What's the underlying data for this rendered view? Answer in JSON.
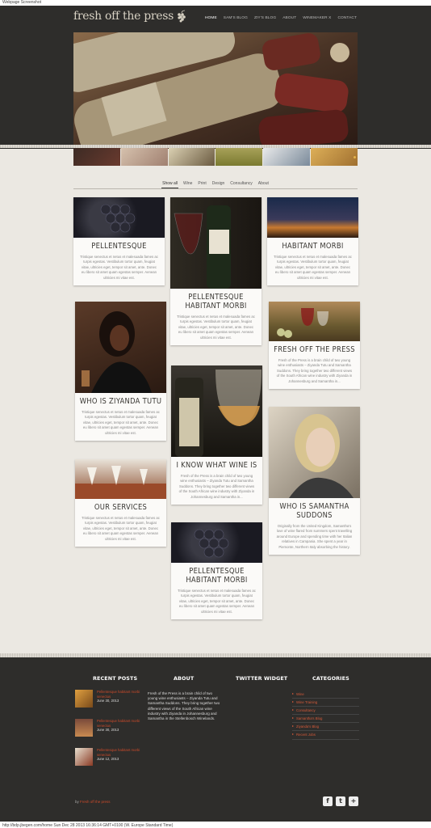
{
  "browser": {
    "top_caption": "Webpage Screenshot",
    "bottom_caption": "http://bdp.jbegen.com/home Sun Dec 28 2013 16:36:14 GMT+0100 (W. Europe Standard Time)"
  },
  "header": {
    "logo_text": "fresh off the press",
    "nav": [
      "HOME",
      "SAM'S BLOG",
      "ZIY'S BLOG",
      "ABOUT",
      "WINEMAKER X",
      "CONTACT"
    ],
    "active_nav": "HOME"
  },
  "filters": {
    "items": [
      "Show all",
      "Wine",
      "Print",
      "Design",
      "Consultancy",
      "About"
    ],
    "active": "Show all"
  },
  "cards": {
    "c1": {
      "title": "PELLENTESQUE",
      "text": "Tristique senectus et netus et malesuada fames ac turpis egestas. Vestibulum tortor quam, feugiat vitae, ultricies eget, tempor sit amet, ante. Donec eu libero sit amet quam egestas semper. Aenean ultricies mi vitae est."
    },
    "c2": {
      "title": "PELLENTESQUE HABITANT MORBI",
      "text": "Tristique senectus et netus et malesuada fames ac turpis egestas. Vestibulum tortor quam, feugiat vitae, ultricies eget, tempor sit amet, ante. Donec eu libero sit amet quam egestas semper. Aenean ultricies mi vitae est."
    },
    "c3": {
      "title": "HABITANT MORBI",
      "text": "Tristique senectus et netus et malesuada fames ac turpis egestas. Vestibulum tortor quam, feugiat vitae, ultricies eget, tempor sit amet, ante. Donec eu libero sit amet quam egestas semper. Aenean ultricies mi vitae est."
    },
    "c4": {
      "title": "WHO IS ZIYANDA TUTU",
      "text": "Tristique senectus et netus et malesuada fames ac turpis egestas. Vestibulum tortor quam, feugiat vitae, ultricies eget, tempor sit amet, ante. Donec eu libero sit amet quam egestas semper. Aenean ultricies mi vitae est."
    },
    "c5": {
      "title": "FRESH OFF THE PRESS",
      "text": "Fresh of the Press is a brain child of two young wine enthusiasts – Ziyanda Tutu and Samantha Suddons. They bring together two different views of the South African wine industry with Ziyanda in Johannesburg and Samantha in..."
    },
    "c6": {
      "title": "I KNOW WHAT WINE IS",
      "text": "Fresh of the Press is a brain child of two young wine enthusiasts – Ziyanda Tutu and Samantha Suddons. They bring together two different views of the South African wine industry with Ziyanda in Johannesburg and Samantha in..."
    },
    "c7": {
      "title": "OUR SERVICES",
      "text": "Tristique senectus et netus et malesuada fames ac turpis egestas. Vestibulum tortor quam, feugiat vitae, ultricies eget, tempor sit amet, ante. Donec eu libero sit amet quam egestas semper. Aenean ultricies mi vitae est."
    },
    "c8": {
      "title": "WHO IS SAMANTHA SUDDONS",
      "text": "Originally from the United Kingdom, Samantha's love of wine flared from summers spent travelling around Europe and spending time with her Italian relatives in Campania. She spent a year in Piemonte, Northern Italy absorbing the history."
    },
    "c9": {
      "title": "PELLENTESQUE HABITANT MORBI",
      "text": "Tristique senectus et netus et malesuada fames ac turpis egestas. Vestibulum tortor quam, feugiat vitae, ultricies eget, tempor sit amet, ante. Donec eu libero sit amet quam egestas semper. Aenean ultricies mi vitae est."
    }
  },
  "footer": {
    "headings": {
      "recent": "RECENT POSTS",
      "about": "ABOUT",
      "twitter": "TWITTER WIDGET",
      "categories": "CATEGORIES"
    },
    "recent_posts": [
      {
        "title": "Pellentesque habitant morbi senectus",
        "date": "June 30, 2013"
      },
      {
        "title": "Pellentesque habitant morbi senectus",
        "date": "June 30, 2013"
      },
      {
        "title": "Pellentesque habitant morbi senectus",
        "date": "June 12, 2013"
      }
    ],
    "about_text": "Fresh of the Press is a brain child of two young wine enthusiasts – Ziyanda Tutu and Samantha Suddons. They bring together two different views of the South African wine industry with Ziyanda in Johannesburg and Samantha in the Stellenbosch Winelands.",
    "categories": [
      "Wine",
      "Wine Training",
      "Consultancy",
      "Samantha's Blog",
      "Ziyanda's Blog",
      "Recent Jobs"
    ],
    "byline_prefix": "by",
    "byline_link": "Fresh off the press",
    "social": [
      "f",
      "t",
      "+"
    ]
  },
  "colors": {
    "header_bg": "#2e2d2b",
    "page_bg": "#ebe8e2",
    "accent": "#cc4a2a"
  }
}
